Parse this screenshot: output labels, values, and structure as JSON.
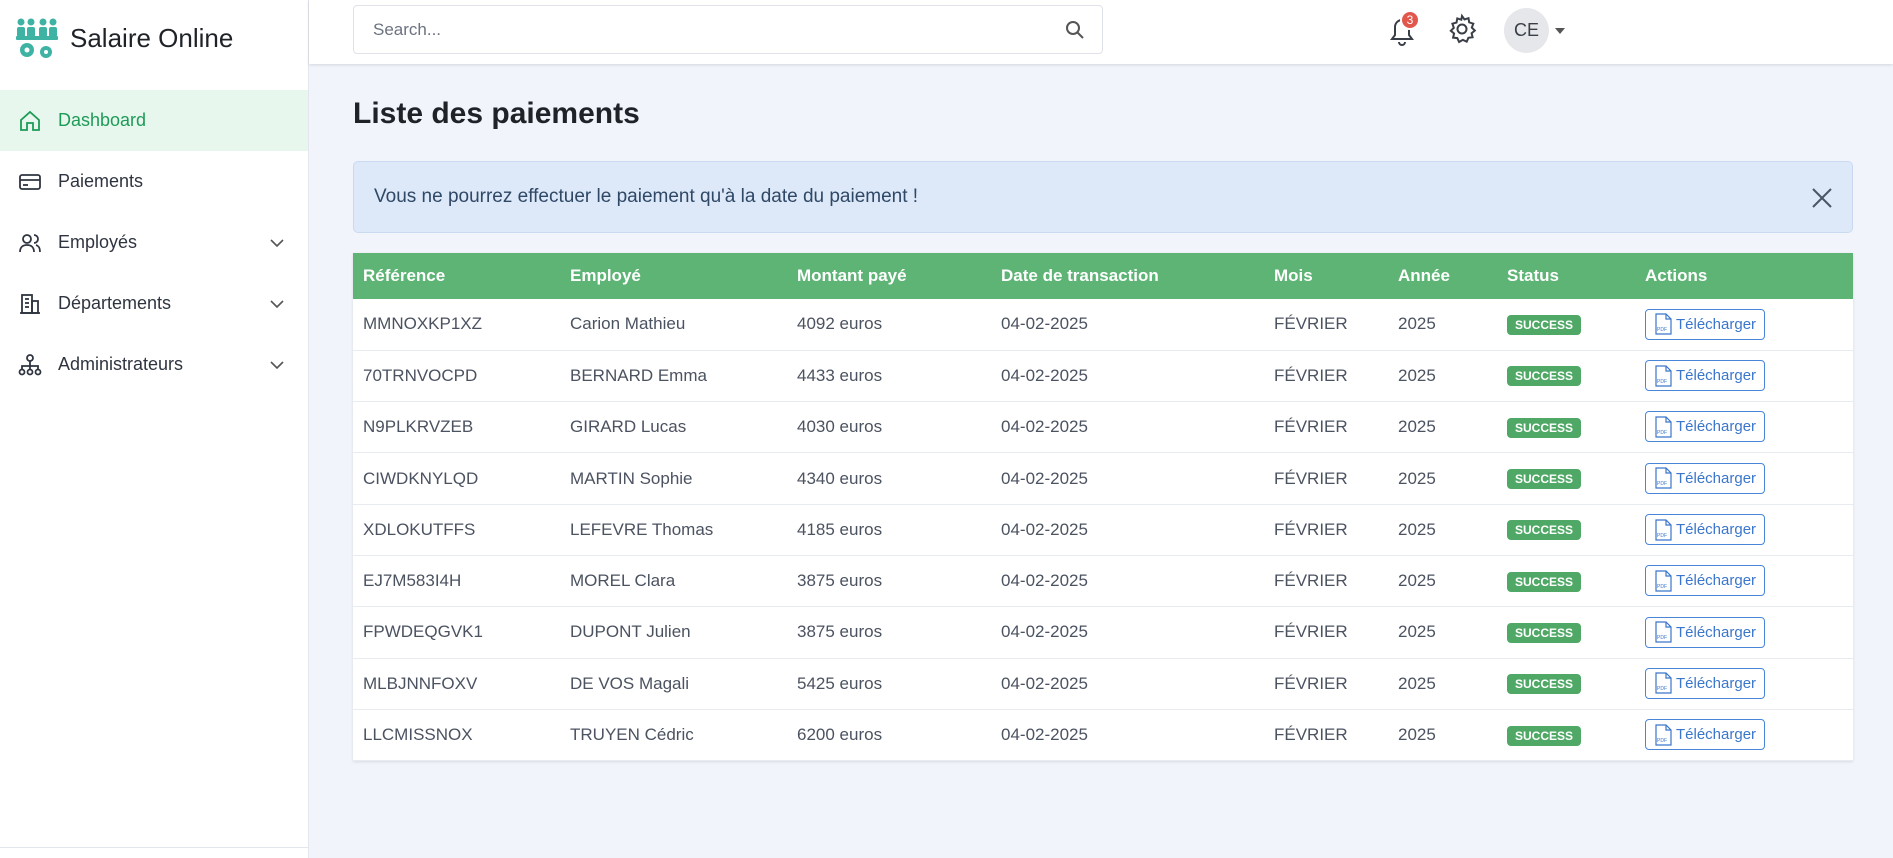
{
  "brand": {
    "name": "Salaire Online"
  },
  "sidebar": {
    "items": [
      {
        "label": "Dashboard",
        "icon": "home-icon",
        "active": true
      },
      {
        "label": "Paiements",
        "icon": "credit-card-icon"
      },
      {
        "label": "Employés",
        "icon": "users-icon",
        "expandable": true
      },
      {
        "label": "Départements",
        "icon": "building-icon",
        "expandable": true
      },
      {
        "label": "Administrateurs",
        "icon": "hierarchy-icon",
        "expandable": true
      }
    ]
  },
  "topbar": {
    "search_placeholder": "Search...",
    "notifications_count": "3",
    "avatar_initials": "CE"
  },
  "page": {
    "title": "Liste des paiements",
    "alert": "Vous ne pourrez effectuer le paiement qu'à la date du paiement !"
  },
  "table": {
    "headers": [
      "Référence",
      "Employé",
      "Montant payé",
      "Date de transaction",
      "Mois",
      "Année",
      "Status",
      "Actions"
    ],
    "download_label": "Télécharger",
    "rows": [
      {
        "ref": "MMNOXKP1XZ",
        "employee": "Carion Mathieu",
        "amount": "4092 euros",
        "date": "04-02-2025",
        "month": "FÉVRIER",
        "year": "2025",
        "status": "SUCCESS"
      },
      {
        "ref": "70TRNVOCPD",
        "employee": "BERNARD Emma",
        "amount": "4433 euros",
        "date": "04-02-2025",
        "month": "FÉVRIER",
        "year": "2025",
        "status": "SUCCESS"
      },
      {
        "ref": "N9PLKRVZEB",
        "employee": "GIRARD Lucas",
        "amount": "4030 euros",
        "date": "04-02-2025",
        "month": "FÉVRIER",
        "year": "2025",
        "status": "SUCCESS"
      },
      {
        "ref": "CIWDKNYLQD",
        "employee": "MARTIN Sophie",
        "amount": "4340 euros",
        "date": "04-02-2025",
        "month": "FÉVRIER",
        "year": "2025",
        "status": "SUCCESS"
      },
      {
        "ref": "XDLOKUTFFS",
        "employee": "LEFEVRE Thomas",
        "amount": "4185 euros",
        "date": "04-02-2025",
        "month": "FÉVRIER",
        "year": "2025",
        "status": "SUCCESS"
      },
      {
        "ref": "EJ7M583I4H",
        "employee": "MOREL Clara",
        "amount": "3875 euros",
        "date": "04-02-2025",
        "month": "FÉVRIER",
        "year": "2025",
        "status": "SUCCESS"
      },
      {
        "ref": "FPWDEQGVK1",
        "employee": "DUPONT Julien",
        "amount": "3875 euros",
        "date": "04-02-2025",
        "month": "FÉVRIER",
        "year": "2025",
        "status": "SUCCESS"
      },
      {
        "ref": "MLBJNNFOXV",
        "employee": "DE VOS Magali",
        "amount": "5425 euros",
        "date": "04-02-2025",
        "month": "FÉVRIER",
        "year": "2025",
        "status": "SUCCESS"
      },
      {
        "ref": "LLCMISSNOX",
        "employee": "TRUYEN Cédric",
        "amount": "6200 euros",
        "date": "04-02-2025",
        "month": "FÉVRIER",
        "year": "2025",
        "status": "SUCCESS"
      }
    ]
  },
  "colors": {
    "accent": "#5db475",
    "active_nav": "#1e9b57",
    "alert_bg": "#dde9f8",
    "badge": "#4fa865",
    "link": "#3a76cc"
  }
}
